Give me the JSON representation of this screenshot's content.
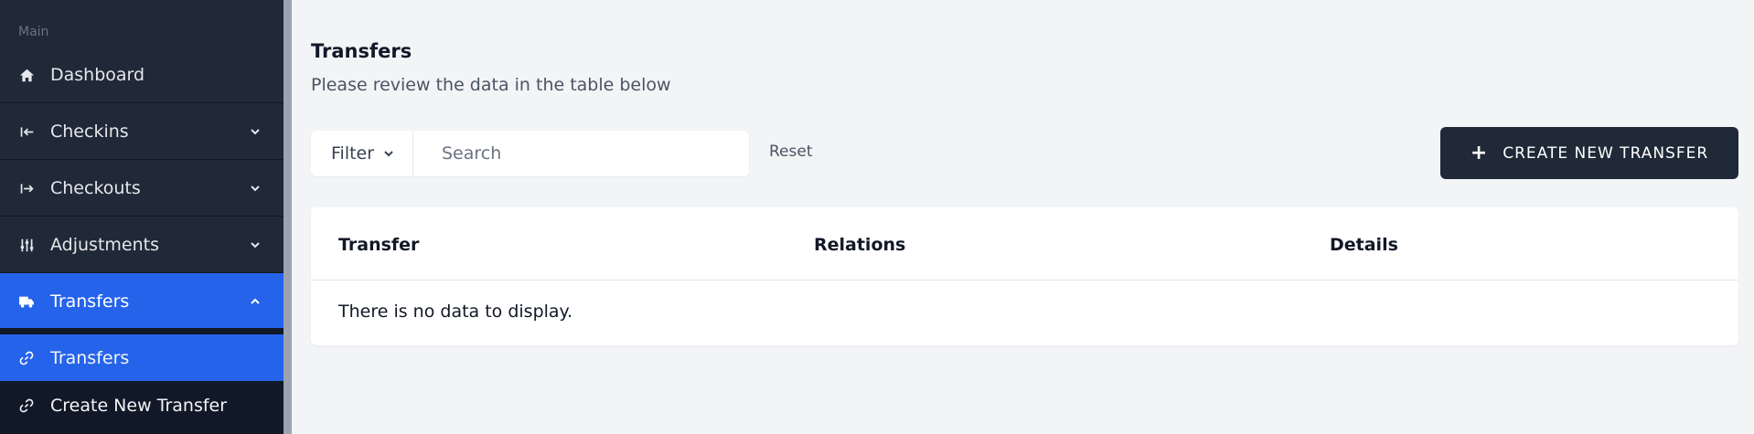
{
  "sidebar": {
    "section_label": "Main",
    "items": [
      {
        "label": "Dashboard",
        "icon": "home-icon"
      },
      {
        "label": "Checkins",
        "icon": "arrow-left-to-line-icon"
      },
      {
        "label": "Checkouts",
        "icon": "arrow-right-to-line-icon"
      },
      {
        "label": "Adjustments",
        "icon": "sliders-icon"
      },
      {
        "label": "Transfers",
        "icon": "truck-icon"
      }
    ],
    "sub_items": [
      {
        "label": "Transfers",
        "icon": "link-icon"
      },
      {
        "label": "Create New Transfer",
        "icon": "link-icon"
      }
    ]
  },
  "header": {
    "title": "Transfers",
    "subtitle": "Please review the data in the table below"
  },
  "toolbar": {
    "filter_label": "Filter",
    "search_placeholder": "Search",
    "reset_label": "Reset",
    "create_label": "CREATE NEW TRANSFER"
  },
  "table": {
    "columns": [
      "Transfer",
      "Relations",
      "Details"
    ],
    "empty_message": "There is no data to display."
  },
  "colors": {
    "sidebar_bg": "#1f2937",
    "accent": "#2563eb",
    "page_bg": "#f3f4f6",
    "button_dark": "#1f2937"
  }
}
